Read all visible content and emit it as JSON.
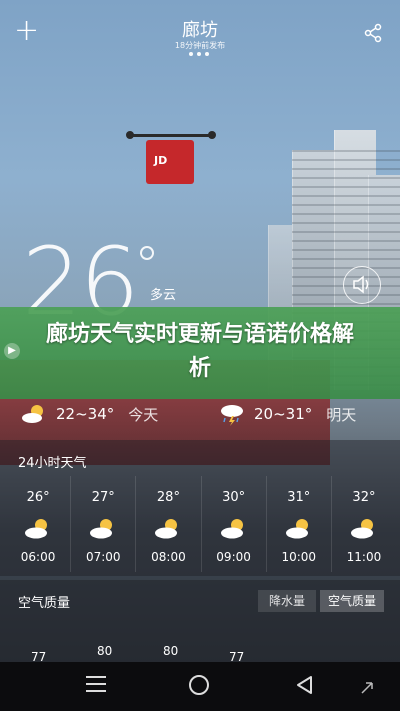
{
  "header": {
    "city": "廊坊",
    "updated": "18分钟前发布",
    "page_dots": 3
  },
  "current": {
    "temperature": "26",
    "condition": "多云"
  },
  "banner": {
    "title": "廊坊天气实时更新与语诺价格解析"
  },
  "summary": {
    "today": {
      "range": "22~34°",
      "label": "今天",
      "icon": "partly-cloudy-icon"
    },
    "tomorrow": {
      "range": "20~31°",
      "label": "明天",
      "icon": "thunderstorm-icon"
    }
  },
  "hourly": {
    "title": "24小时天气",
    "items": [
      {
        "temp": "26°",
        "time": "06:00",
        "icon": "partly-cloudy-icon"
      },
      {
        "temp": "27°",
        "time": "07:00",
        "icon": "partly-cloudy-icon"
      },
      {
        "temp": "28°",
        "time": "08:00",
        "icon": "partly-cloudy-icon"
      },
      {
        "temp": "30°",
        "time": "09:00",
        "icon": "partly-cloudy-icon"
      },
      {
        "temp": "31°",
        "time": "10:00",
        "icon": "partly-cloudy-icon"
      },
      {
        "temp": "32°",
        "time": "11:00",
        "icon": "partly-cloudy-icon"
      }
    ]
  },
  "air_quality": {
    "title": "空气质量",
    "tab_rain": "降水量",
    "tab_aq": "空气质量",
    "values": [
      "77",
      "80",
      "80",
      "77"
    ]
  },
  "colors": {
    "banner_green": "#3f9a4e",
    "sun_yellow": "#f6c343"
  }
}
